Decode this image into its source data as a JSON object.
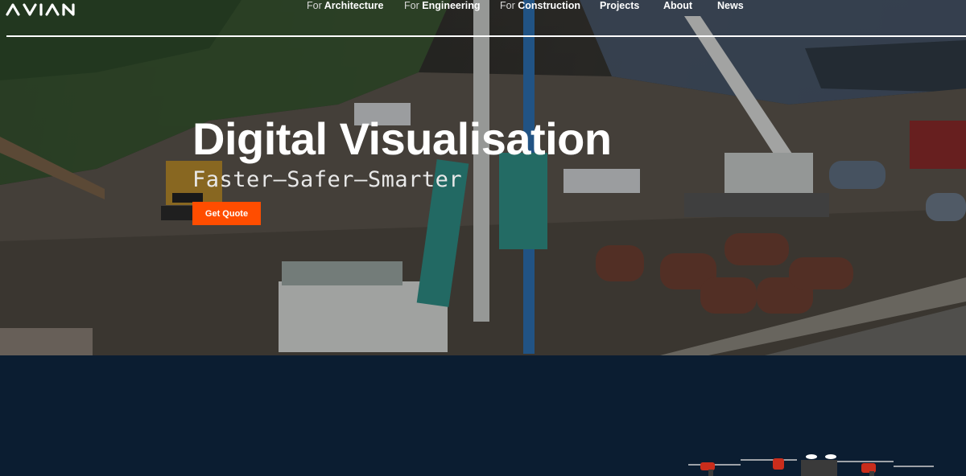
{
  "nav": {
    "logo_text": "avian",
    "items": [
      {
        "prefix": "For",
        "label": "Architecture"
      },
      {
        "prefix": "For",
        "label": "Engineering"
      },
      {
        "prefix": "For",
        "label": "Construction"
      },
      {
        "prefix": "",
        "label": "Projects"
      },
      {
        "prefix": "",
        "label": "About"
      },
      {
        "prefix": "",
        "label": "News"
      }
    ]
  },
  "hero": {
    "title": "Digital Visualisation",
    "subtitle": "Faster–Safer–Smarter",
    "cta_label": "Get Quote"
  },
  "colors": {
    "accent": "#ff4d00",
    "section_bg": "#0b1d31",
    "nav_line": "#ffffff"
  }
}
